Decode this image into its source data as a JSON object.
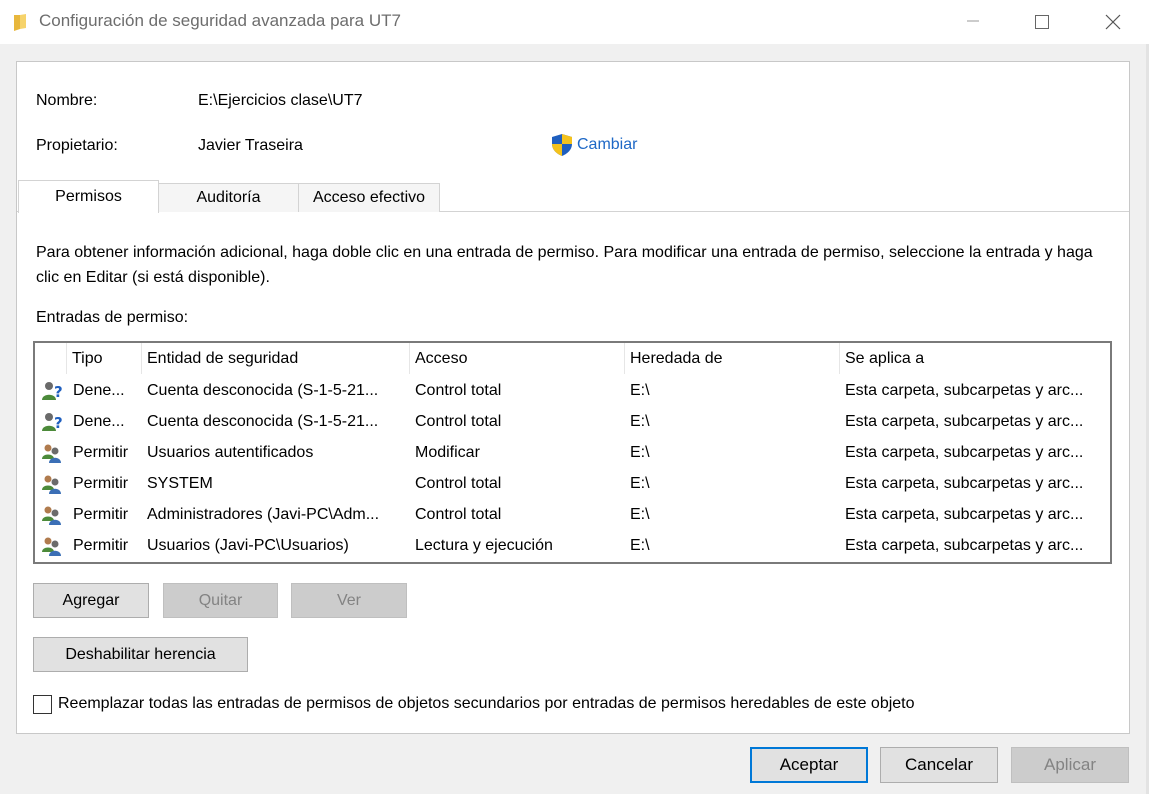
{
  "window": {
    "title": "Configuración de seguridad avanzada para UT7",
    "minimize_icon": "minimize-icon",
    "maximize_icon": "maximize-icon",
    "close_icon": "close-icon"
  },
  "header": {
    "name_label": "Nombre:",
    "name_value": "E:\\Ejercicios clase\\UT7",
    "owner_label": "Propietario:",
    "owner_value": "Javier Traseira",
    "change_label": "Cambiar",
    "change_icon": "uac-shield-icon"
  },
  "tabs": [
    {
      "label": "Permisos",
      "active": true
    },
    {
      "label": "Auditoría",
      "active": false
    },
    {
      "label": "Acceso efectivo",
      "active": false
    }
  ],
  "permissions": {
    "info_text": "Para obtener información adicional, haga doble clic en una entrada de permiso. Para modificar una entrada de permiso, seleccione la entrada y haga clic en Editar (si está disponible).",
    "entries_label": "Entradas de permiso:",
    "columns": [
      "Tipo",
      "Entidad de seguridad",
      "Acceso",
      "Heredada de",
      "Se aplica a"
    ],
    "rows": [
      {
        "icon": "unknown-user-icon",
        "tipo": "Dene...",
        "entidad": "Cuenta desconocida (S-1-5-21...",
        "acceso": "Control total",
        "heredada": "E:\\",
        "aplica": "Esta carpeta, subcarpetas y arc..."
      },
      {
        "icon": "unknown-user-icon",
        "tipo": "Dene...",
        "entidad": "Cuenta desconocida (S-1-5-21...",
        "acceso": "Control total",
        "heredada": "E:\\",
        "aplica": "Esta carpeta, subcarpetas y arc..."
      },
      {
        "icon": "users-group-icon",
        "tipo": "Permitir",
        "entidad": "Usuarios autentificados",
        "acceso": "Modificar",
        "heredada": "E:\\",
        "aplica": "Esta carpeta, subcarpetas y arc..."
      },
      {
        "icon": "users-group-icon",
        "tipo": "Permitir",
        "entidad": "SYSTEM",
        "acceso": "Control total",
        "heredada": "E:\\",
        "aplica": "Esta carpeta, subcarpetas y arc..."
      },
      {
        "icon": "users-group-icon",
        "tipo": "Permitir",
        "entidad": "Administradores (Javi-PC\\Adm...",
        "acceso": "Control total",
        "heredada": "E:\\",
        "aplica": "Esta carpeta, subcarpetas y arc..."
      },
      {
        "icon": "users-group-icon",
        "tipo": "Permitir",
        "entidad": "Usuarios (Javi-PC\\Usuarios)",
        "acceso": "Lectura y ejecución",
        "heredada": "E:\\",
        "aplica": "Esta carpeta, subcarpetas y arc..."
      }
    ],
    "buttons": {
      "add": "Agregar",
      "remove": "Quitar",
      "view": "Ver",
      "disable_inheritance": "Deshabilitar herencia"
    },
    "replace_checkbox_label": "Reemplazar todas las entradas de permisos de objetos secundarios por entradas de permisos heredables de este objeto",
    "replace_checked": false
  },
  "footer": {
    "ok": "Aceptar",
    "cancel": "Cancelar",
    "apply": "Aplicar"
  },
  "colors": {
    "link": "#1e68c6",
    "default_button_border": "#0078d7"
  }
}
